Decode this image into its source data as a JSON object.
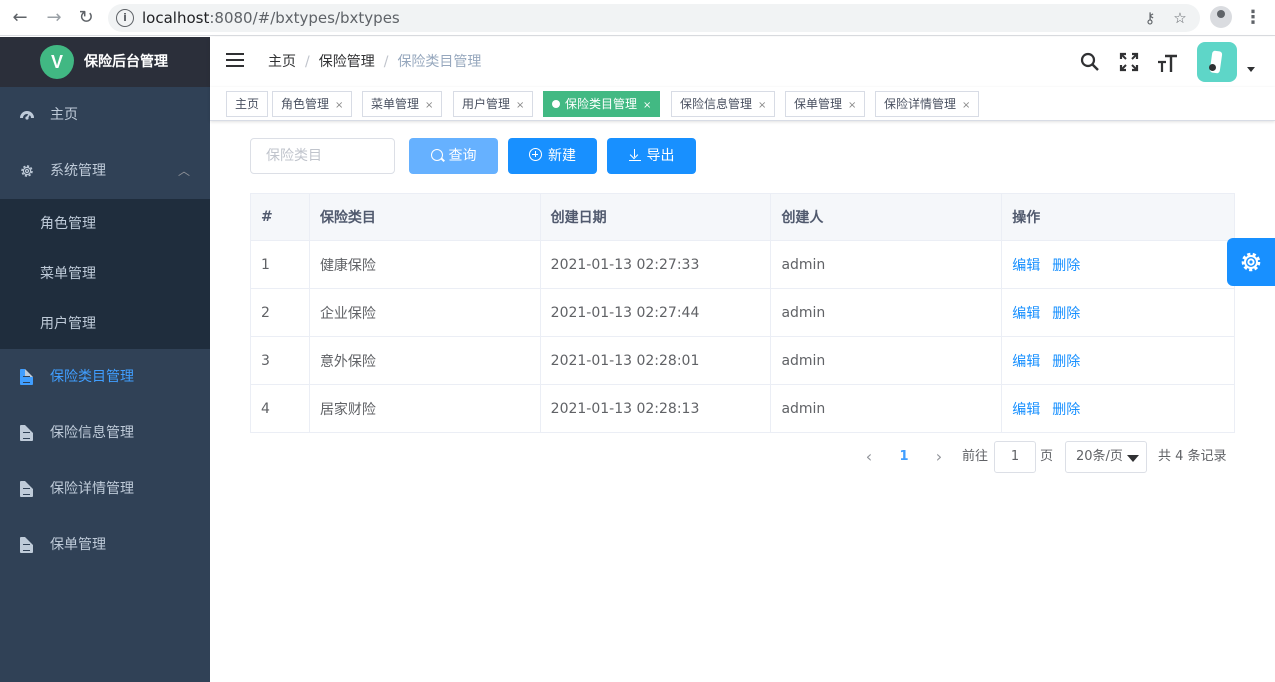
{
  "browser": {
    "url_host": "localhost",
    "url_rest": ":8080/#/bxtypes/bxtypes",
    "info_glyph": "i",
    "back_glyph": "←",
    "forward_glyph": "→",
    "reload_glyph": "↻",
    "key_glyph": "⚷",
    "star_glyph": "☆",
    "menu_glyph": "⋮"
  },
  "sidebar": {
    "logo_letter": "V",
    "title": "保险后台管理",
    "items": [
      {
        "label": "主页",
        "icon": "dashboard-icon"
      },
      {
        "label": "系统管理",
        "icon": "gear-icon"
      },
      {
        "label": "保险类目管理",
        "icon": "document-icon"
      },
      {
        "label": "保险信息管理",
        "icon": "document-icon"
      },
      {
        "label": "保险详情管理",
        "icon": "document-icon"
      },
      {
        "label": "保单管理",
        "icon": "document-icon"
      }
    ],
    "submenu": [
      "角色管理",
      "菜单管理",
      "用户管理"
    ],
    "chevron": "︿",
    "active_color": "#409eff"
  },
  "header": {
    "breadcrumb": [
      "主页",
      "保险管理",
      "保险类目管理"
    ],
    "separator": "/",
    "icons": [
      "search-icon",
      "fullscreen-icon",
      "font-size-icon"
    ]
  },
  "tags": [
    {
      "label": "主页",
      "closable": false
    },
    {
      "label": "角色管理",
      "closable": true
    },
    {
      "label": "菜单管理",
      "closable": true
    },
    {
      "label": "用户管理",
      "closable": true
    },
    {
      "label": "保险类目管理",
      "closable": true,
      "active": true
    },
    {
      "label": "保险信息管理",
      "closable": true
    },
    {
      "label": "保单管理",
      "closable": true
    },
    {
      "label": "保险详情管理",
      "closable": true
    }
  ],
  "tag_close": "×",
  "toolbar": {
    "search_placeholder": "保险类目",
    "query_label": "查询",
    "new_label": "新建",
    "export_label": "导出"
  },
  "table": {
    "headers": [
      "#",
      "保险类目",
      "创建日期",
      "创建人",
      "操作"
    ],
    "rows": [
      {
        "id": "1",
        "name": "健康保险",
        "date": "2021-01-13 02:27:33",
        "creator": "admin"
      },
      {
        "id": "2",
        "name": "企业保险",
        "date": "2021-01-13 02:27:44",
        "creator": "admin"
      },
      {
        "id": "3",
        "name": "意外保险",
        "date": "2021-01-13 02:28:01",
        "creator": "admin"
      },
      {
        "id": "4",
        "name": "居家财险",
        "date": "2021-01-13 02:28:13",
        "creator": "admin"
      }
    ],
    "edit_label": "编辑",
    "delete_label": "删除"
  },
  "pagination": {
    "prev": "‹",
    "next": "›",
    "current_page": "1",
    "goto_prefix": "前往",
    "goto_value": "1",
    "goto_suffix": "页",
    "page_size": "20条/页",
    "total_text": "共 4 条记录"
  },
  "colors": {
    "sidebar_bg": "#304156",
    "active_tag": "#42b983",
    "primary": "#1890ff"
  }
}
